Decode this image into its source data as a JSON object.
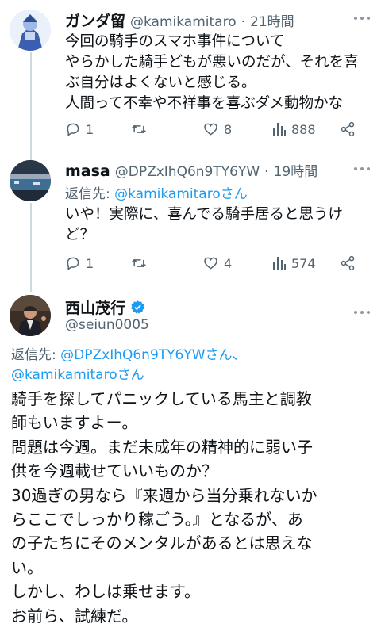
{
  "tweet1": {
    "display_name": "ガンダ留",
    "handle": "@kamikamitaro",
    "time": "21時間",
    "lines": [
      "今回の騎手のスマホ事件について",
      "やらかした騎手どもが悪いのだが、それを喜",
      "ぶ自分はよくないと感じる。",
      "人間って不幸や不祥事を喜ぶダメ動物かな"
    ],
    "replies": "1",
    "retweets": "",
    "likes": "8",
    "views": "888"
  },
  "tweet2": {
    "display_name": "masa",
    "handle": "@DPZxIhQ6n9TY6YW",
    "time": "19時間",
    "reply_label": "返信先:",
    "reply_mention": "@kamikamitaroさん",
    "lines": [
      "いや！実際に、喜んでる騎手居ると思うけ",
      "ど？"
    ],
    "replies": "1",
    "retweets": "",
    "likes": "4",
    "views": "574"
  },
  "tweet3": {
    "display_name": "西山茂行",
    "handle": "@seiun0005",
    "reply_label": "返信先:",
    "reply_mention_1": "@DPZxIhQ6n9TY6YWさん、",
    "reply_mention_2": "@kamikamitaroさん",
    "lines": [
      "騎手を探してパニックしている馬主と調教",
      "師もいますよー。",
      "問題は今週。まだ未成年の精神的に弱い子",
      "供を今週載せていいものか？",
      "30過ぎの男なら『来週から当分乗れないか",
      "らここでしっかり稼ごう。』となるが、あ",
      "の子たちにそのメンタルがあるとは思えな",
      "い。",
      "しかし、わしは乗せます。",
      "お前ら、試練だ。"
    ]
  },
  "colors": {
    "accent": "#1d9bf0",
    "muted": "#536471",
    "text": "#0f1419",
    "line": "#cfd9de"
  },
  "icons": [
    "reply-icon",
    "retweet-icon",
    "like-icon",
    "views-icon",
    "share-icon",
    "more-icon",
    "verified-icon"
  ]
}
